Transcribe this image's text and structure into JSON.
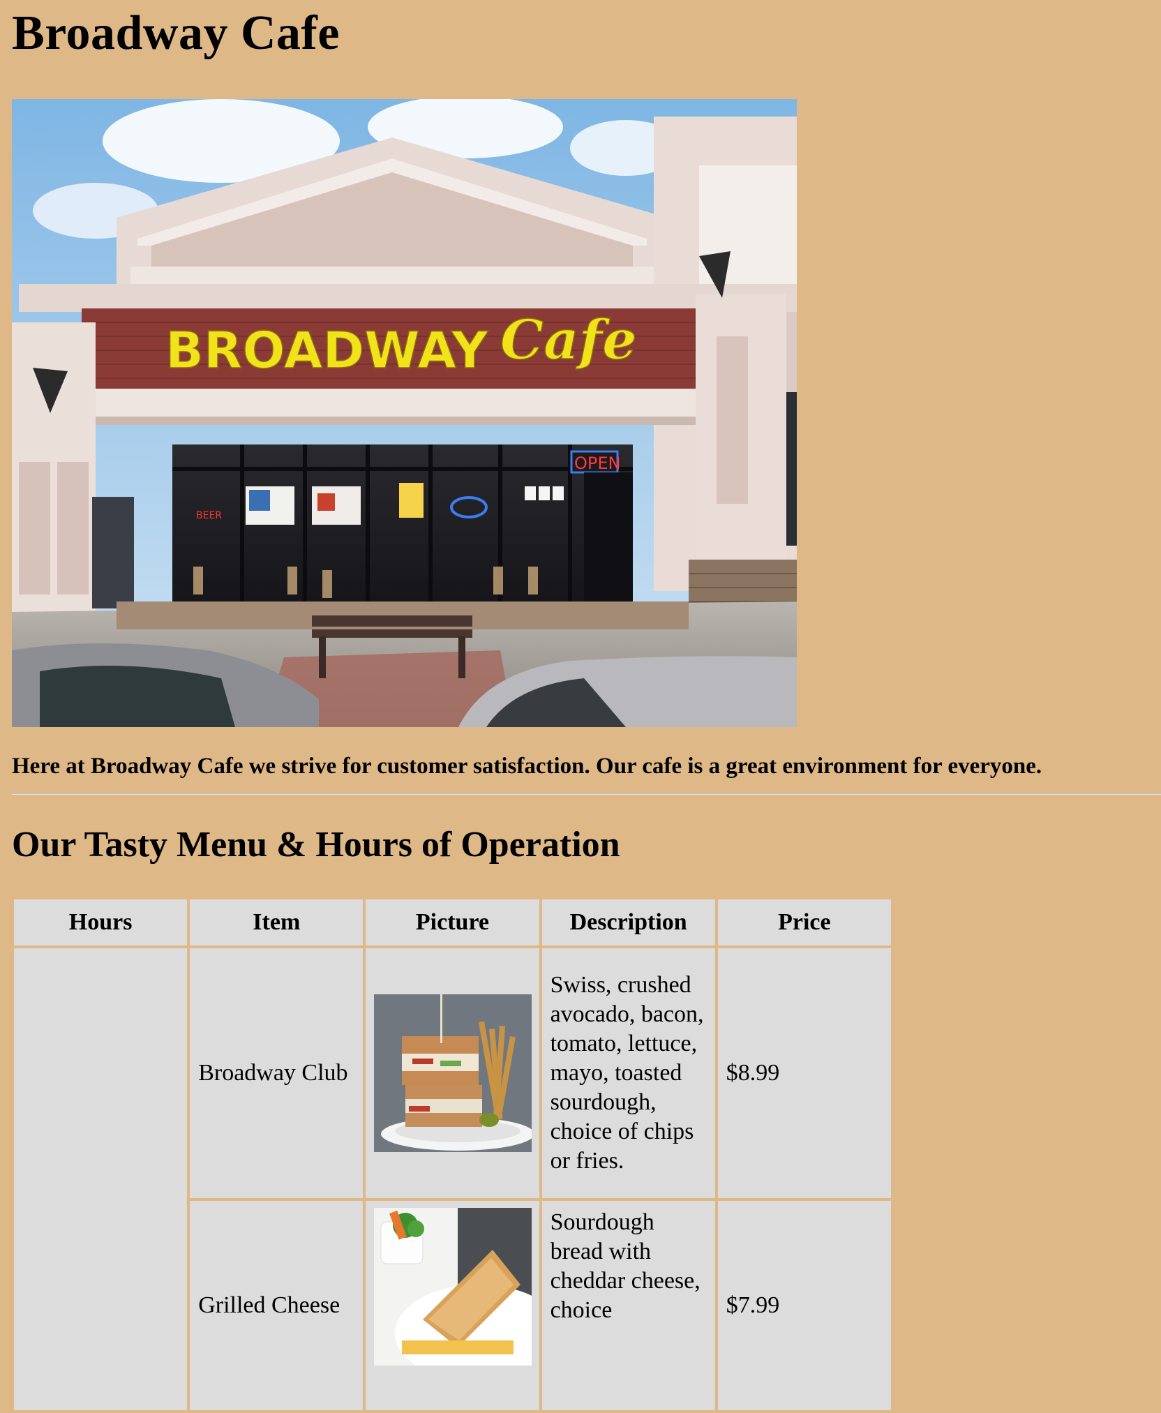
{
  "page": {
    "title": "Broadway Cafe",
    "hero_image_alt": "Broadway Cafe storefront",
    "sign_text": "BROADWAY",
    "sign_script": "Cafe",
    "open_sign": "OPEN",
    "intro": "Here at Broadway Cafe we strive for customer satisfaction. Our cafe is a great environment for everyone.",
    "section_heading": "Our Tasty Menu & Hours of Operation"
  },
  "menu": {
    "headers": [
      "Hours",
      "Item",
      "Picture",
      "Description",
      "Price"
    ],
    "hours_text": "",
    "rows": [
      {
        "item": "Broadway Club",
        "description": "Swiss, crushed avocado, bacon, tomato, lettuce, mayo, toasted sourdough, choice of chips or fries.",
        "price": "$8.99",
        "picture_icon": "club-sandwich-photo"
      },
      {
        "item": "Grilled Cheese",
        "description": "Sourdough bread with cheddar cheese, choice",
        "price": "$7.99",
        "picture_icon": "grilled-cheese-photo"
      }
    ]
  },
  "colors": {
    "background": "#deb887",
    "table_cell": "#dcdcdc",
    "sign_yellow": "#f2e21a",
    "brick": "#8a3b36"
  }
}
